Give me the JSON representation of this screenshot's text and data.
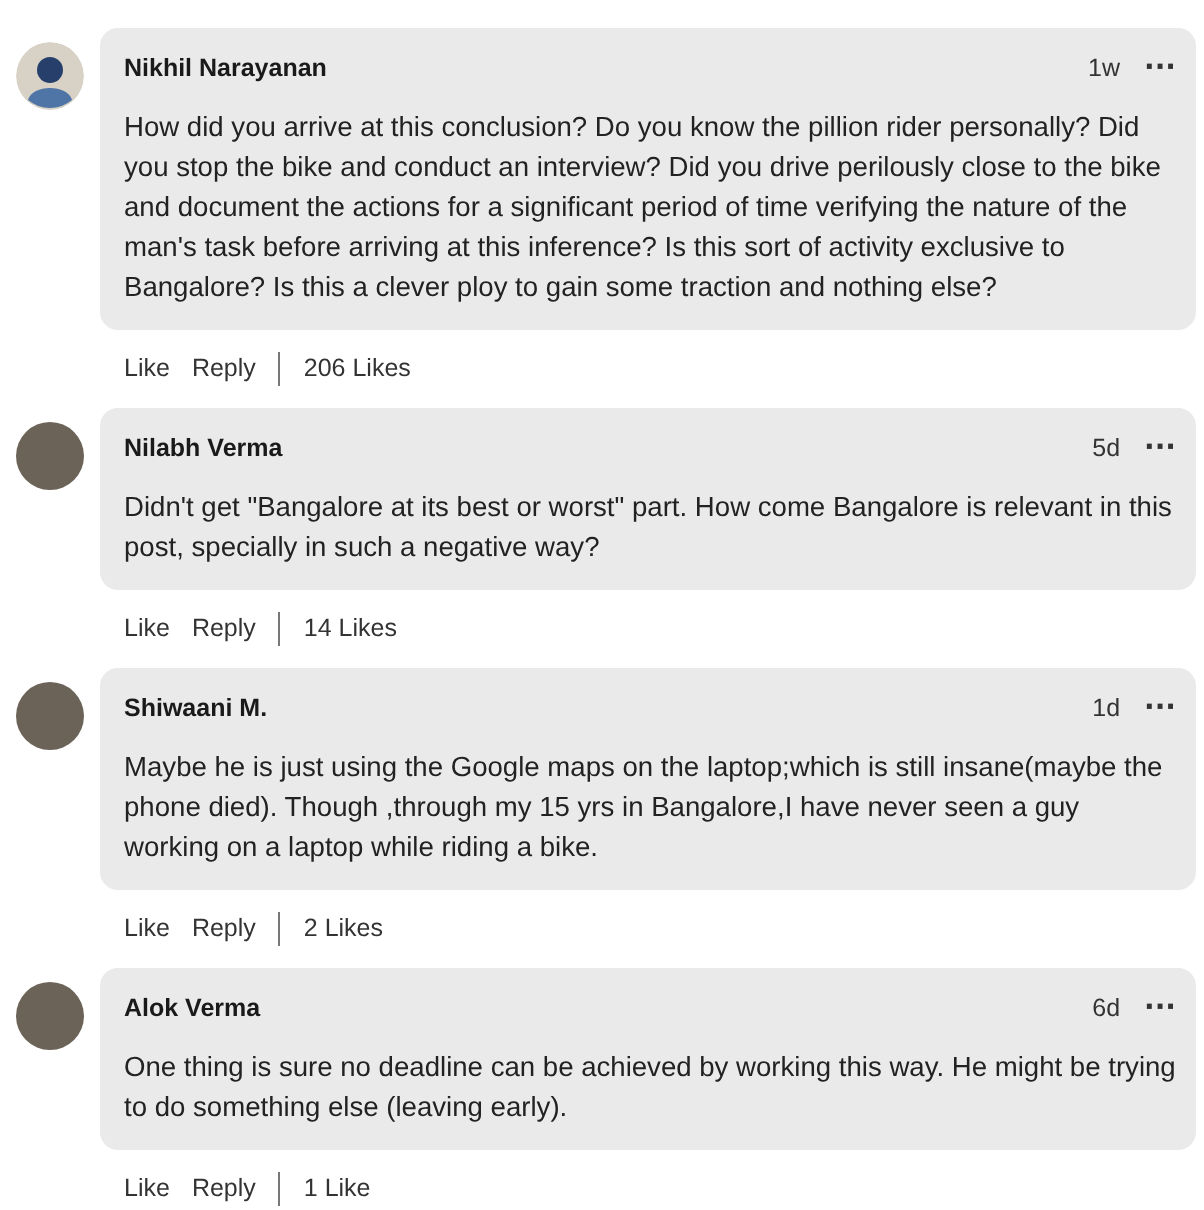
{
  "comments": [
    {
      "author": "Nikhil Narayanan",
      "kind": "silhouette",
      "time": "1w",
      "menu": "···",
      "text": "How did you arrive at this conclusion? Do you know the pillion rider personally? Did you stop the bike and conduct an interview? Did you drive perilously close to the bike and document the actions for a significant period of time verifying the nature of the man's task before arriving at this inference? Is this sort of activity exclusive to Bangalore? Is this a clever ploy to gain some traction and nothing else?",
      "like": "Like",
      "reply": "Reply",
      "likes": "206 Likes"
    },
    {
      "author": "Nilabh Verma",
      "kind": "photo",
      "time": "5d",
      "menu": "···",
      "text": "Didn't get \"Bangalore at its best or worst\" part. How come Bangalore is relevant in this post, specially in such a negative way?",
      "like": "Like",
      "reply": "Reply",
      "likes": "14 Likes"
    },
    {
      "author": "Shiwaani M.",
      "kind": "photo",
      "time": "1d",
      "menu": "···",
      "text": "Maybe he is just using the Google maps on the laptop;which is still insane(maybe the phone died). Though ,through my 15 yrs in Bangalore,I have never seen a guy working on a laptop while riding a bike.",
      "like": "Like",
      "reply": "Reply",
      "likes": "2 Likes"
    },
    {
      "author": "Alok Verma",
      "kind": "photo",
      "time": "6d",
      "menu": "···",
      "text": "One thing is sure no deadline can be achieved by working this way. He might be trying to do something else (leaving early).",
      "like": "Like",
      "reply": "Reply",
      "likes": "1 Like"
    }
  ]
}
